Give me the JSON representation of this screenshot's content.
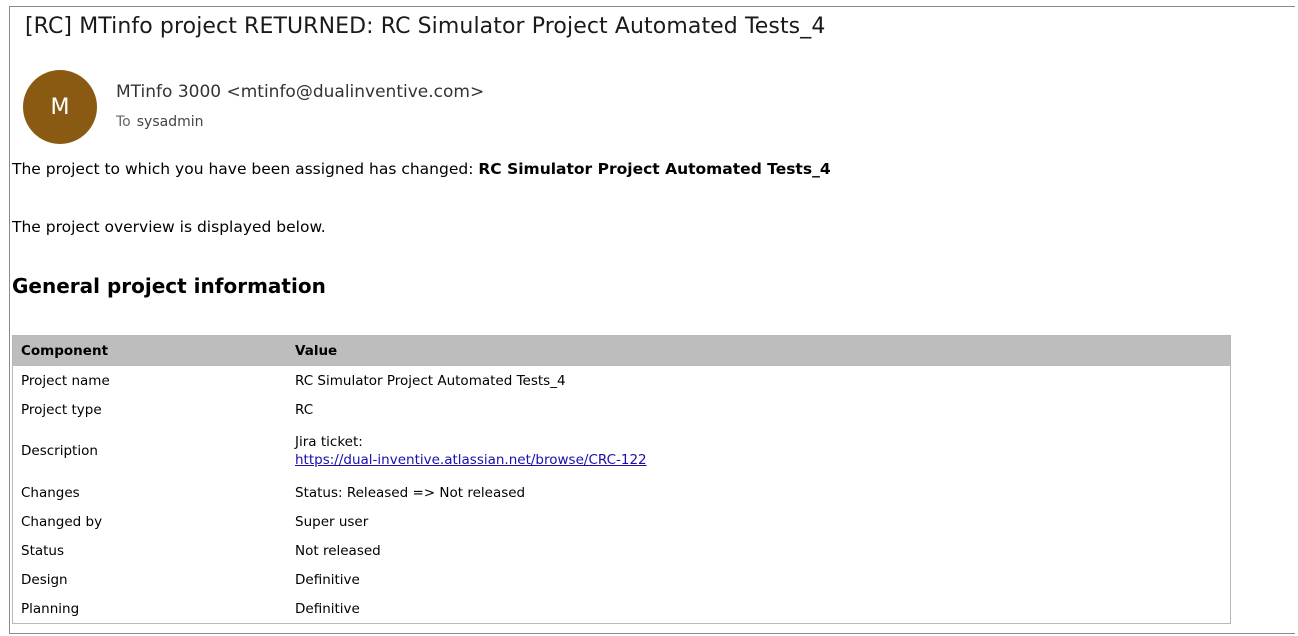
{
  "email": {
    "subject": "[RC] MTinfo project RETURNED: RC Simulator Project Automated Tests_4",
    "sender": {
      "avatar_letter": "M",
      "avatar_color": "#8a5a12",
      "display": "MTinfo 3000 <mtinfo@dualinventive.com>"
    },
    "recipient": {
      "to_label": "To",
      "name": "sysadmin"
    },
    "body": {
      "line1_prefix": "The project to which you have been assigned has changed: ",
      "line1_project": "RC Simulator Project Automated Tests_4",
      "line2": "The project overview is displayed below.",
      "section_heading": "General project information"
    }
  },
  "table": {
    "headers": [
      "Component",
      "Value"
    ],
    "header_bg": "#bdbdbd",
    "rows": [
      {
        "component": "Project name",
        "value": "RC Simulator Project Automated Tests_4"
      },
      {
        "component": "Project type",
        "value": "RC"
      },
      {
        "component": "Description",
        "value": "Jira ticket:",
        "link": "https://dual-inventive.atlassian.net/browse/CRC-122"
      },
      {
        "component": "Changes",
        "value": "Status: Released => Not released"
      },
      {
        "component": "Changed by",
        "value": "Super user"
      },
      {
        "component": "Status",
        "value": "Not released"
      },
      {
        "component": "Design",
        "value": "Definitive"
      },
      {
        "component": "Planning",
        "value": "Definitive"
      }
    ],
    "link_color": "#1a0dab"
  }
}
